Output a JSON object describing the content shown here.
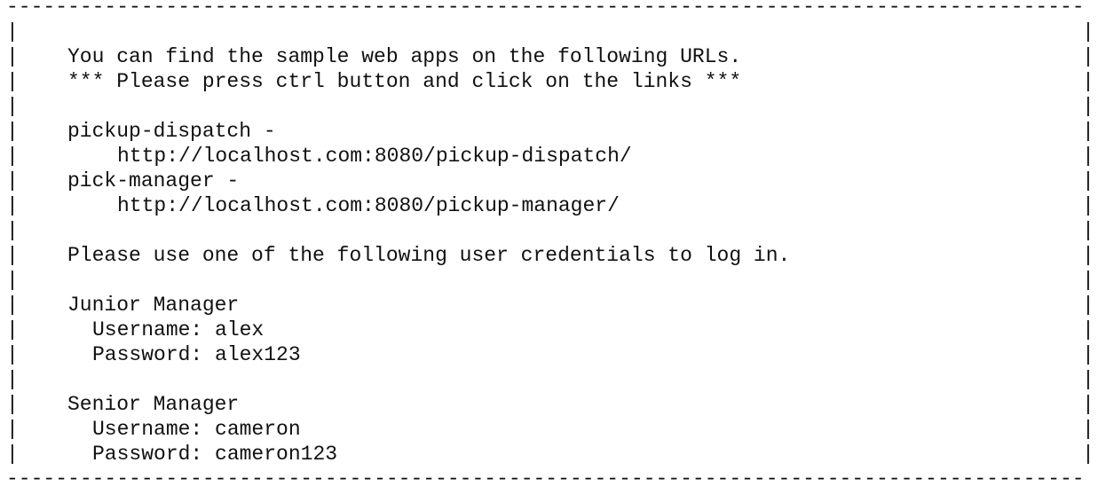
{
  "frame": {
    "border": "----------------------------------------------------------------------------------------",
    "pipe": "|"
  },
  "intro": {
    "line1": "You can find the sample web apps on the following URLs.",
    "line2": "*** Please press ctrl button and click on the links ***"
  },
  "apps": [
    {
      "name": "pickup-dispatch -",
      "url": "http://localhost.com:8080/pickup-dispatch/"
    },
    {
      "name": "pick-manager -",
      "url": "http://localhost.com:8080/pickup-manager/"
    }
  ],
  "credentials_intro": "Please use one of the following user credentials to log in.",
  "users": [
    {
      "role": "Junior Manager",
      "username": "Username: alex",
      "password": "Password: alex123"
    },
    {
      "role": "Senior Manager",
      "username": "Username: cameron",
      "password": "Password: cameron123"
    }
  ]
}
